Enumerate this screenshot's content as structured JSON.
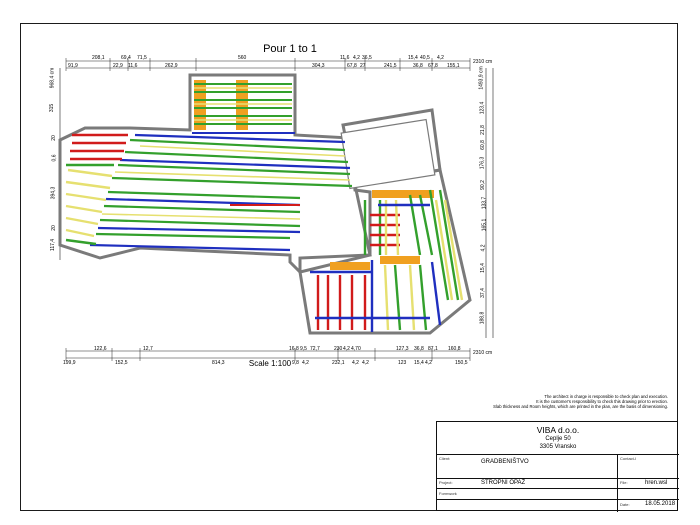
{
  "header": {
    "title": "Pour 1 to 1",
    "scale": "Scale 1:100"
  },
  "dimensions": {
    "top_row1": [
      "208,1",
      "69,4",
      "71,5",
      "560",
      "11,6",
      "4,2",
      "36,5",
      "15,4",
      "40,5",
      "4,2"
    ],
    "top_row2": [
      "91,9",
      "22,9",
      "11,6",
      "262,9",
      "304,3",
      "67,8",
      "27",
      "241,5",
      "36,8",
      "67,8",
      "155,1"
    ],
    "top_total": "2310 cm",
    "bottom_row1": [
      "122,6",
      "12,7",
      "16,8",
      "9,5",
      "72,7",
      "230",
      "4,2",
      "4,70",
      "127,3",
      "36,8",
      "87,1",
      "160,8"
    ],
    "bottom_row2": [
      "199,9",
      "152,5",
      "814,3",
      "9,8",
      "4,2",
      "232,1",
      "4,2",
      "4,2",
      "123",
      "15,4",
      "4,2",
      "150,5"
    ],
    "bottom_total": "2310 cm",
    "left_col": [
      "968,4 cm",
      "315",
      "20",
      "0,6",
      "394,3",
      "20",
      "117,4"
    ],
    "right_col": [
      "1493,9 cm",
      "123,4",
      "21,8",
      "60,8",
      "176,3",
      "90,2",
      "133,7",
      "165,1",
      "4,2",
      "15,4",
      "37,4",
      "188,8"
    ]
  },
  "notes": [
    "The architect in charge is responsible to check plan and execution.",
    "It is the customer's responsibility to check this drawing prior to erection.",
    "Slab thickness and Room heights, which are printed in the plan, are the basis of dimensioning."
  ],
  "title_block": {
    "company": "VIBA d.o.o.",
    "street": "Ceplje 50",
    "city": "3305 Vransko",
    "client_caption": "Client:",
    "client": "GRADBENIŠTVO",
    "contact_caption": "Contact-I",
    "project_caption": "Project:",
    "project": "STROPNI OPAŽ",
    "file_caption": "File:",
    "file": "hren.wsl",
    "formwork_caption": "Formwork",
    "date_caption": "Date:",
    "date": "18.05.2018"
  },
  "colors": {
    "beam_green": "#33a02c",
    "beam_blue": "#1f2fbf",
    "beam_red": "#d11b1b",
    "beam_yellow": "#e6e070",
    "header_orange": "#f0a020",
    "slab_edge": "#7a7a7a"
  }
}
